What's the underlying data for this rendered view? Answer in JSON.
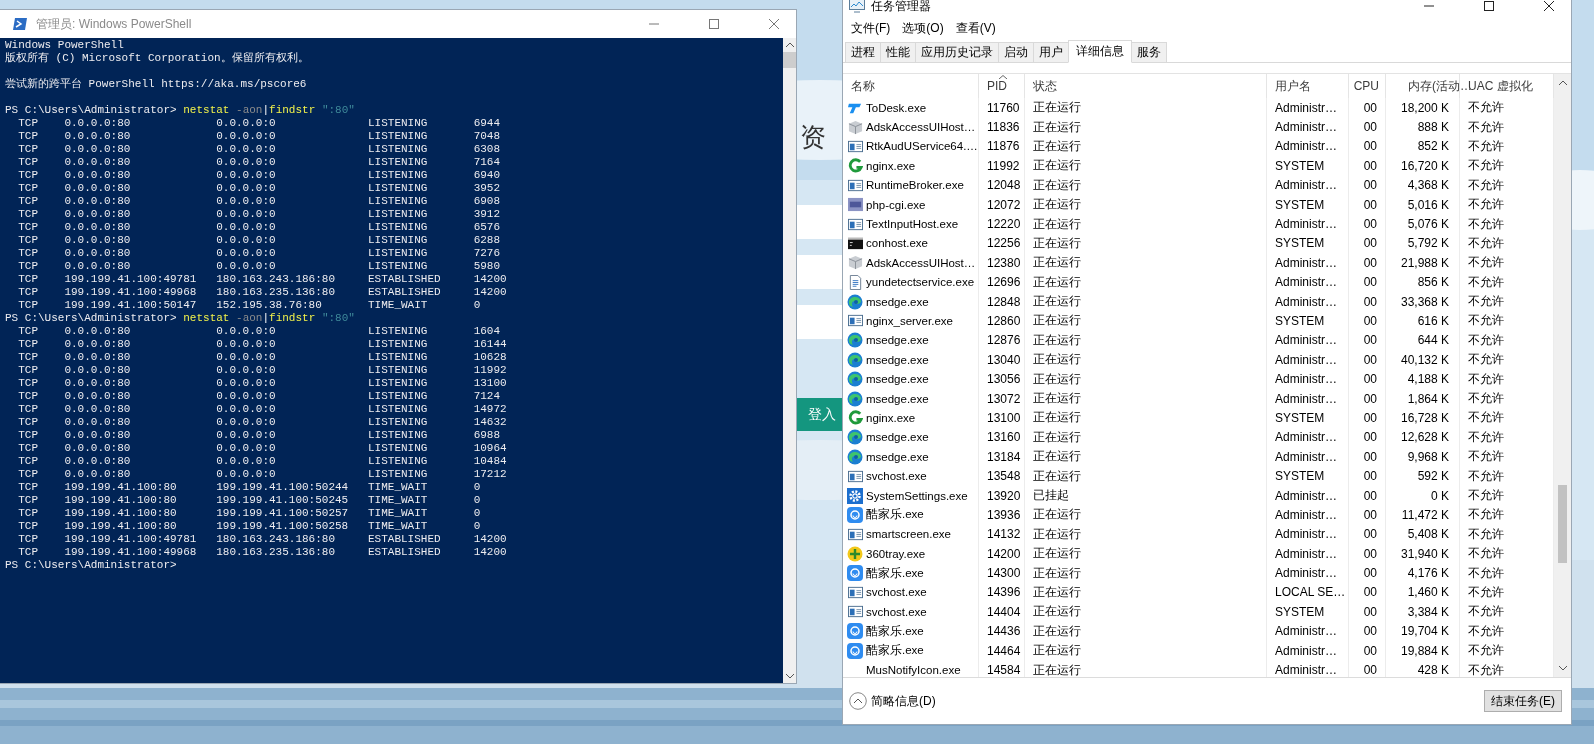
{
  "background_page": {
    "heading": "资",
    "login_button": "登入"
  },
  "powershell": {
    "title": "管理员: Windows PowerShell",
    "lines": [
      {
        "kind": "text",
        "text": "Windows PowerShell"
      },
      {
        "kind": "text",
        "text": "版权所有 (C) Microsoft Corporation。保留所有权利。"
      },
      {
        "kind": "blank"
      },
      {
        "kind": "text",
        "text": "尝试新的跨平台 PowerShell https://aka.ms/pscore6"
      },
      {
        "kind": "blank"
      },
      {
        "kind": "prompt",
        "prompt": "PS C:\\Users\\Administrator>",
        "command": [
          {
            "text": "netstat",
            "kind": "cmd"
          },
          {
            "text": "-aon",
            "kind": "param"
          },
          {
            "text": "|",
            "kind": "pipe"
          },
          {
            "text": "findstr",
            "kind": "cmd"
          },
          {
            "text": "\":80\"",
            "kind": "string"
          }
        ]
      },
      {
        "kind": "conn",
        "proto": "TCP",
        "local": "0.0.0.0:80",
        "foreign": "0.0.0.0:0",
        "state": "LISTENING",
        "pid": "6944"
      },
      {
        "kind": "conn",
        "proto": "TCP",
        "local": "0.0.0.0:80",
        "foreign": "0.0.0.0:0",
        "state": "LISTENING",
        "pid": "7048"
      },
      {
        "kind": "conn",
        "proto": "TCP",
        "local": "0.0.0.0:80",
        "foreign": "0.0.0.0:0",
        "state": "LISTENING",
        "pid": "6308"
      },
      {
        "kind": "conn",
        "proto": "TCP",
        "local": "0.0.0.0:80",
        "foreign": "0.0.0.0:0",
        "state": "LISTENING",
        "pid": "7164"
      },
      {
        "kind": "conn",
        "proto": "TCP",
        "local": "0.0.0.0:80",
        "foreign": "0.0.0.0:0",
        "state": "LISTENING",
        "pid": "6940"
      },
      {
        "kind": "conn",
        "proto": "TCP",
        "local": "0.0.0.0:80",
        "foreign": "0.0.0.0:0",
        "state": "LISTENING",
        "pid": "3952"
      },
      {
        "kind": "conn",
        "proto": "TCP",
        "local": "0.0.0.0:80",
        "foreign": "0.0.0.0:0",
        "state": "LISTENING",
        "pid": "6908"
      },
      {
        "kind": "conn",
        "proto": "TCP",
        "local": "0.0.0.0:80",
        "foreign": "0.0.0.0:0",
        "state": "LISTENING",
        "pid": "3912"
      },
      {
        "kind": "conn",
        "proto": "TCP",
        "local": "0.0.0.0:80",
        "foreign": "0.0.0.0:0",
        "state": "LISTENING",
        "pid": "6576"
      },
      {
        "kind": "conn",
        "proto": "TCP",
        "local": "0.0.0.0:80",
        "foreign": "0.0.0.0:0",
        "state": "LISTENING",
        "pid": "6288"
      },
      {
        "kind": "conn",
        "proto": "TCP",
        "local": "0.0.0.0:80",
        "foreign": "0.0.0.0:0",
        "state": "LISTENING",
        "pid": "7276"
      },
      {
        "kind": "conn",
        "proto": "TCP",
        "local": "0.0.0.0:80",
        "foreign": "0.0.0.0:0",
        "state": "LISTENING",
        "pid": "5980"
      },
      {
        "kind": "conn",
        "proto": "TCP",
        "local": "199.199.41.100:49781",
        "foreign": "180.163.243.186:80",
        "state": "ESTABLISHED",
        "pid": "14200"
      },
      {
        "kind": "conn",
        "proto": "TCP",
        "local": "199.199.41.100:49968",
        "foreign": "180.163.235.136:80",
        "state": "ESTABLISHED",
        "pid": "14200"
      },
      {
        "kind": "conn",
        "proto": "TCP",
        "local": "199.199.41.100:50147",
        "foreign": "152.195.38.76:80",
        "state": "TIME_WAIT",
        "pid": "0"
      },
      {
        "kind": "prompt",
        "prompt": "PS C:\\Users\\Administrator>",
        "command": [
          {
            "text": "netstat",
            "kind": "cmd"
          },
          {
            "text": "-aon",
            "kind": "param"
          },
          {
            "text": "|",
            "kind": "pipe"
          },
          {
            "text": "findstr",
            "kind": "cmd"
          },
          {
            "text": "\":80\"",
            "kind": "string"
          }
        ]
      },
      {
        "kind": "conn",
        "proto": "TCP",
        "local": "0.0.0.0:80",
        "foreign": "0.0.0.0:0",
        "state": "LISTENING",
        "pid": "1604"
      },
      {
        "kind": "conn",
        "proto": "TCP",
        "local": "0.0.0.0:80",
        "foreign": "0.0.0.0:0",
        "state": "LISTENING",
        "pid": "16144"
      },
      {
        "kind": "conn",
        "proto": "TCP",
        "local": "0.0.0.0:80",
        "foreign": "0.0.0.0:0",
        "state": "LISTENING",
        "pid": "10628"
      },
      {
        "kind": "conn",
        "proto": "TCP",
        "local": "0.0.0.0:80",
        "foreign": "0.0.0.0:0",
        "state": "LISTENING",
        "pid": "11992"
      },
      {
        "kind": "conn",
        "proto": "TCP",
        "local": "0.0.0.0:80",
        "foreign": "0.0.0.0:0",
        "state": "LISTENING",
        "pid": "13100"
      },
      {
        "kind": "conn",
        "proto": "TCP",
        "local": "0.0.0.0:80",
        "foreign": "0.0.0.0:0",
        "state": "LISTENING",
        "pid": "7124"
      },
      {
        "kind": "conn",
        "proto": "TCP",
        "local": "0.0.0.0:80",
        "foreign": "0.0.0.0:0",
        "state": "LISTENING",
        "pid": "14972"
      },
      {
        "kind": "conn",
        "proto": "TCP",
        "local": "0.0.0.0:80",
        "foreign": "0.0.0.0:0",
        "state": "LISTENING",
        "pid": "14632"
      },
      {
        "kind": "conn",
        "proto": "TCP",
        "local": "0.0.0.0:80",
        "foreign": "0.0.0.0:0",
        "state": "LISTENING",
        "pid": "6988"
      },
      {
        "kind": "conn",
        "proto": "TCP",
        "local": "0.0.0.0:80",
        "foreign": "0.0.0.0:0",
        "state": "LISTENING",
        "pid": "10964"
      },
      {
        "kind": "conn",
        "proto": "TCP",
        "local": "0.0.0.0:80",
        "foreign": "0.0.0.0:0",
        "state": "LISTENING",
        "pid": "10484"
      },
      {
        "kind": "conn",
        "proto": "TCP",
        "local": "0.0.0.0:80",
        "foreign": "0.0.0.0:0",
        "state": "LISTENING",
        "pid": "17212"
      },
      {
        "kind": "conn",
        "proto": "TCP",
        "local": "199.199.41.100:80",
        "foreign": "199.199.41.100:50244",
        "state": "TIME_WAIT",
        "pid": "0"
      },
      {
        "kind": "conn",
        "proto": "TCP",
        "local": "199.199.41.100:80",
        "foreign": "199.199.41.100:50245",
        "state": "TIME_WAIT",
        "pid": "0"
      },
      {
        "kind": "conn",
        "proto": "TCP",
        "local": "199.199.41.100:80",
        "foreign": "199.199.41.100:50257",
        "state": "TIME_WAIT",
        "pid": "0"
      },
      {
        "kind": "conn",
        "proto": "TCP",
        "local": "199.199.41.100:80",
        "foreign": "199.199.41.100:50258",
        "state": "TIME_WAIT",
        "pid": "0"
      },
      {
        "kind": "conn",
        "proto": "TCP",
        "local": "199.199.41.100:49781",
        "foreign": "180.163.243.186:80",
        "state": "ESTABLISHED",
        "pid": "14200"
      },
      {
        "kind": "conn",
        "proto": "TCP",
        "local": "199.199.41.100:49968",
        "foreign": "180.163.235.136:80",
        "state": "ESTABLISHED",
        "pid": "14200"
      },
      {
        "kind": "prompt",
        "prompt": "PS C:\\Users\\Administrator>"
      }
    ]
  },
  "task_manager": {
    "title": "任务管理器",
    "menu": [
      "文件(F)",
      "选项(O)",
      "查看(V)"
    ],
    "tabs": [
      {
        "label": "进程",
        "selected": false
      },
      {
        "label": "性能",
        "selected": false
      },
      {
        "label": "应用历史记录",
        "selected": false
      },
      {
        "label": "启动",
        "selected": false
      },
      {
        "label": "用户",
        "selected": false
      },
      {
        "label": "详细信息",
        "selected": true
      },
      {
        "label": "服务",
        "selected": false
      }
    ],
    "columns": [
      {
        "label": "名称",
        "sorted": false
      },
      {
        "label": "PID",
        "sorted": true
      },
      {
        "label": "状态",
        "sorted": false
      },
      {
        "label": "用户名",
        "sorted": false
      },
      {
        "label": "CPU",
        "sorted": false
      },
      {
        "label": "内存(活动…",
        "sorted": false
      },
      {
        "label": "UAC 虚拟化",
        "sorted": false
      }
    ],
    "rows": [
      {
        "kind": "todesk",
        "name": "ToDesk.exe",
        "pid": "11760",
        "status": "正在运行",
        "user": "Administr…",
        "cpu": "00",
        "memory": "18,200 K",
        "uac": "不允许"
      },
      {
        "kind": "box",
        "name": "AdskAccessUIHost…",
        "pid": "11836",
        "status": "正在运行",
        "user": "Administr…",
        "cpu": "00",
        "memory": "888 K",
        "uac": "不允许"
      },
      {
        "kind": "window",
        "name": "RtkAudUService64.…",
        "pid": "11876",
        "status": "正在运行",
        "user": "Administr…",
        "cpu": "00",
        "memory": "852 K",
        "uac": "不允许"
      },
      {
        "kind": "nginx",
        "name": "nginx.exe",
        "pid": "11992",
        "status": "正在运行",
        "user": "SYSTEM",
        "cpu": "00",
        "memory": "16,720 K",
        "uac": "不允许"
      },
      {
        "kind": "window",
        "name": "RuntimeBroker.exe",
        "pid": "12048",
        "status": "正在运行",
        "user": "Administr…",
        "cpu": "00",
        "memory": "4,368 K",
        "uac": "不允许"
      },
      {
        "kind": "php",
        "name": "php-cgi.exe",
        "pid": "12072",
        "status": "正在运行",
        "user": "SYSTEM",
        "cpu": "00",
        "memory": "5,016 K",
        "uac": "不允许"
      },
      {
        "kind": "window",
        "name": "TextInputHost.exe",
        "pid": "12220",
        "status": "正在运行",
        "user": "Administr…",
        "cpu": "00",
        "memory": "5,076 K",
        "uac": "不允许"
      },
      {
        "kind": "console",
        "name": "conhost.exe",
        "pid": "12256",
        "status": "正在运行",
        "user": "SYSTEM",
        "cpu": "00",
        "memory": "5,792 K",
        "uac": "不允许"
      },
      {
        "kind": "box",
        "name": "AdskAccessUIHost…",
        "pid": "12380",
        "status": "正在运行",
        "user": "Administr…",
        "cpu": "00",
        "memory": "21,988 K",
        "uac": "不允许"
      },
      {
        "kind": "document",
        "name": "yundetectservice.exe",
        "pid": "12696",
        "status": "正在运行",
        "user": "Administr…",
        "cpu": "00",
        "memory": "856 K",
        "uac": "不允许"
      },
      {
        "kind": "edge",
        "name": "msedge.exe",
        "pid": "12848",
        "status": "正在运行",
        "user": "Administr…",
        "cpu": "00",
        "memory": "33,368 K",
        "uac": "不允许"
      },
      {
        "kind": "window",
        "name": "nginx_server.exe",
        "pid": "12860",
        "status": "正在运行",
        "user": "SYSTEM",
        "cpu": "00",
        "memory": "616 K",
        "uac": "不允许"
      },
      {
        "kind": "edge",
        "name": "msedge.exe",
        "pid": "12876",
        "status": "正在运行",
        "user": "Administr…",
        "cpu": "00",
        "memory": "644 K",
        "uac": "不允许"
      },
      {
        "kind": "edge",
        "name": "msedge.exe",
        "pid": "13040",
        "status": "正在运行",
        "user": "Administr…",
        "cpu": "00",
        "memory": "40,132 K",
        "uac": "不允许"
      },
      {
        "kind": "edge",
        "name": "msedge.exe",
        "pid": "13056",
        "status": "正在运行",
        "user": "Administr…",
        "cpu": "00",
        "memory": "4,188 K",
        "uac": "不允许"
      },
      {
        "kind": "edge",
        "name": "msedge.exe",
        "pid": "13072",
        "status": "正在运行",
        "user": "Administr…",
        "cpu": "00",
        "memory": "1,864 K",
        "uac": "不允许"
      },
      {
        "kind": "nginx",
        "name": "nginx.exe",
        "pid": "13100",
        "status": "正在运行",
        "user": "SYSTEM",
        "cpu": "00",
        "memory": "16,728 K",
        "uac": "不允许"
      },
      {
        "kind": "edge",
        "name": "msedge.exe",
        "pid": "13160",
        "status": "正在运行",
        "user": "Administr…",
        "cpu": "00",
        "memory": "12,628 K",
        "uac": "不允许"
      },
      {
        "kind": "edge",
        "name": "msedge.exe",
        "pid": "13184",
        "status": "正在运行",
        "user": "Administr…",
        "cpu": "00",
        "memory": "9,968 K",
        "uac": "不允许"
      },
      {
        "kind": "window",
        "name": "svchost.exe",
        "pid": "13548",
        "status": "正在运行",
        "user": "SYSTEM",
        "cpu": "00",
        "memory": "592 K",
        "uac": "不允许"
      },
      {
        "kind": "gear",
        "name": "SystemSettings.exe",
        "pid": "13920",
        "status": "已挂起",
        "user": "Administr…",
        "cpu": "00",
        "memory": "0 K",
        "uac": "不允许"
      },
      {
        "kind": "badge",
        "name": "酷家乐.exe",
        "pid": "13936",
        "status": "正在运行",
        "user": "Administr…",
        "cpu": "00",
        "memory": "11,472 K",
        "uac": "不允许"
      },
      {
        "kind": "window",
        "name": "smartscreen.exe",
        "pid": "14132",
        "status": "正在运行",
        "user": "Administr…",
        "cpu": "00",
        "memory": "5,408 K",
        "uac": "不允许"
      },
      {
        "kind": "plus",
        "name": "360tray.exe",
        "pid": "14200",
        "status": "正在运行",
        "user": "Administr…",
        "cpu": "00",
        "memory": "31,940 K",
        "uac": "不允许"
      },
      {
        "kind": "badge",
        "name": "酷家乐.exe",
        "pid": "14300",
        "status": "正在运行",
        "user": "Administr…",
        "cpu": "00",
        "memory": "4,176 K",
        "uac": "不允许"
      },
      {
        "kind": "window",
        "name": "svchost.exe",
        "pid": "14396",
        "status": "正在运行",
        "user": "LOCAL SE…",
        "cpu": "00",
        "memory": "1,460 K",
        "uac": "不允许"
      },
      {
        "kind": "window",
        "name": "svchost.exe",
        "pid": "14404",
        "status": "正在运行",
        "user": "SYSTEM",
        "cpu": "00",
        "memory": "3,384 K",
        "uac": "不允许"
      },
      {
        "kind": "badge",
        "name": "酷家乐.exe",
        "pid": "14436",
        "status": "正在运行",
        "user": "Administr…",
        "cpu": "00",
        "memory": "19,704 K",
        "uac": "不允许"
      },
      {
        "kind": "badge",
        "name": "酷家乐.exe",
        "pid": "14464",
        "status": "正在运行",
        "user": "Administr…",
        "cpu": "00",
        "memory": "19,884 K",
        "uac": "不允许"
      },
      {
        "kind": "none",
        "name": "MusNotifyIcon.exe",
        "pid": "14584",
        "status": "正在运行",
        "user": "Administr…",
        "cpu": "00",
        "memory": "428 K",
        "uac": "不允许"
      }
    ],
    "fewer_details": "简略信息(D)",
    "end_task": "结束任务(E)"
  }
}
